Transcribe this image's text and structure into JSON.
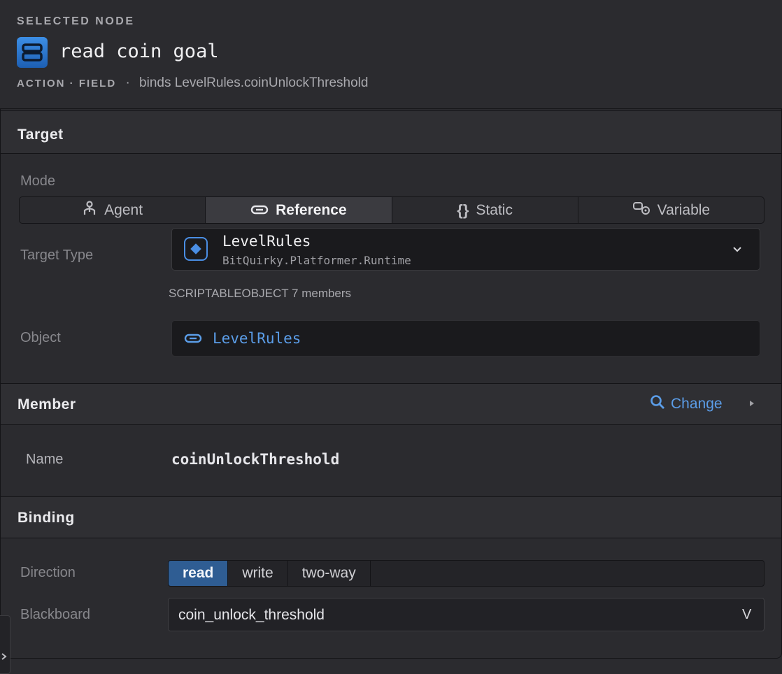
{
  "header": {
    "section_label": "SELECTED NODE",
    "icon": "node-type-icon",
    "title": "read coin goal",
    "kind": "ACTION · FIELD",
    "separator": "·",
    "binds_text": "binds LevelRules.coinUnlockThreshold"
  },
  "target": {
    "title": "Target",
    "mode_label": "Mode",
    "modes": [
      {
        "label": "Agent",
        "icon": "agent-icon",
        "active": false
      },
      {
        "label": "Reference",
        "icon": "link-icon",
        "active": true
      },
      {
        "label": "Static",
        "icon": "braces-icon",
        "active": false
      },
      {
        "label": "Variable",
        "icon": "variable-icon",
        "active": false
      }
    ],
    "target_type_label": "Target Type",
    "type_name": "LevelRules",
    "type_namespace": "BitQuirky.Platformer.Runtime",
    "type_meta": "SCRIPTABLEOBJECT 7 members",
    "object_label": "Object",
    "object_value": "LevelRules"
  },
  "member": {
    "title": "Member",
    "change_label": "Change",
    "name_label": "Name",
    "name_value": "coinUnlockThreshold"
  },
  "binding": {
    "title": "Binding",
    "direction_label": "Direction",
    "directions": [
      "read",
      "write",
      "two-way"
    ],
    "selected_direction": "read",
    "blackboard_label": "Blackboard",
    "blackboard_value": "coin_unlock_threshold",
    "blackboard_chevron": "V"
  },
  "colors": {
    "accent": "#2f5d93",
    "link": "#5b9de8",
    "background": "#2b2b2f"
  }
}
